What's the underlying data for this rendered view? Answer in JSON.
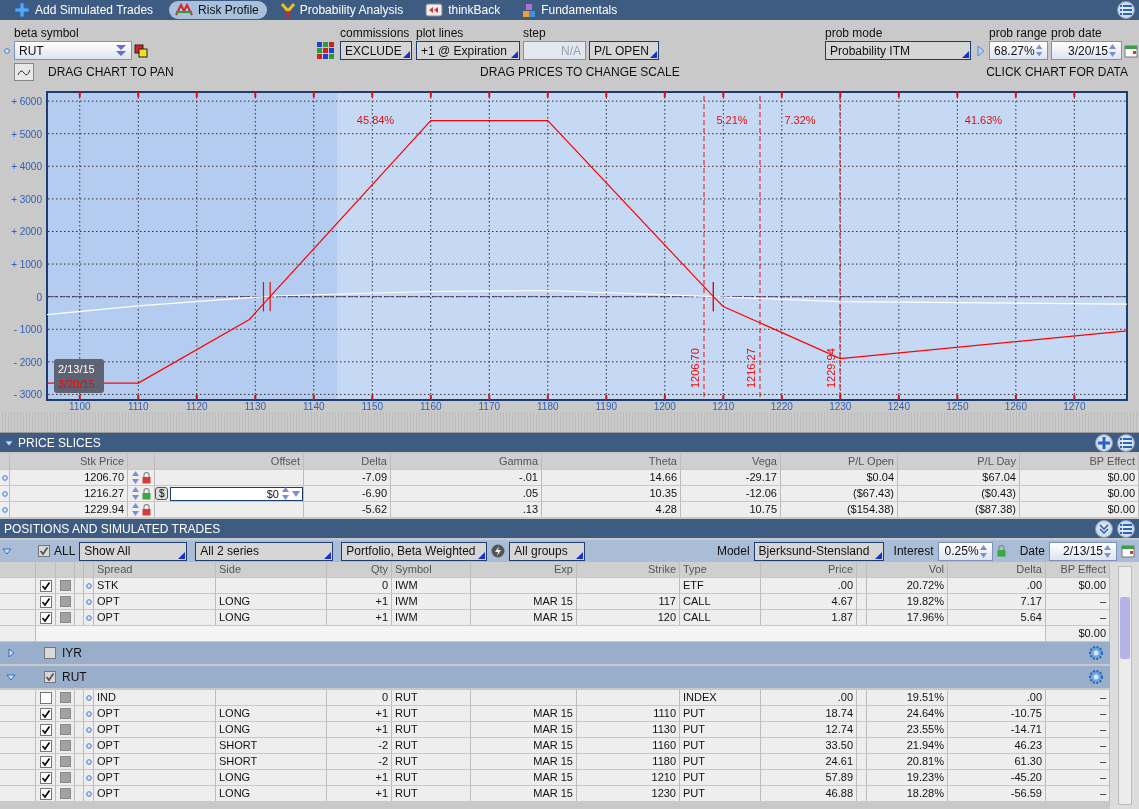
{
  "tabs": [
    {
      "label": "Add Simulated Trades",
      "selected": false
    },
    {
      "label": "Risk Profile",
      "selected": true
    },
    {
      "label": "Probability Analysis",
      "selected": false
    },
    {
      "label": "thinkBack",
      "selected": false
    },
    {
      "label": "Fundamentals",
      "selected": false
    }
  ],
  "controls": {
    "beta_symbol": {
      "label": "beta symbol",
      "value": "RUT"
    },
    "commissions": {
      "label": "commissions",
      "value": "EXCLUDE"
    },
    "plot_lines": {
      "label": "plot lines",
      "value": "+1 @ Expiration"
    },
    "step": {
      "label": "step",
      "value": "N/A",
      "disabled": true
    },
    "pl_mode": {
      "value": "P/L OPEN"
    },
    "prob_mode": {
      "label": "prob mode",
      "value": "Probability ITM"
    },
    "prob_range": {
      "label": "prob range",
      "value": "68.27%"
    },
    "prob_date": {
      "label": "prob date",
      "value": "3/20/15"
    }
  },
  "hints": [
    "DRAG CHART TO PAN",
    "DRAG PRICES TO CHANGE SCALE",
    "CLICK CHART FOR DATA"
  ],
  "chart": {
    "chart_data": {
      "type": "line",
      "x": [
        1094.4,
        1110,
        1129,
        1133,
        1160,
        1180,
        1208.3,
        1210,
        1230,
        1279
      ],
      "series": [
        {
          "name": "2/13/15",
          "color": "#ffffff",
          "values": [
            -550,
            -280,
            -30,
            20,
            160,
            190,
            0,
            -10,
            -150,
            -230
          ]
        },
        {
          "name": "3/20/15",
          "color": "#ff0000",
          "values": [
            -2650,
            -2650,
            -700,
            90,
            5400,
            5400,
            0,
            -300,
            -1900,
            -1050
          ]
        }
      ],
      "xlim": [
        1094.4,
        1279
      ],
      "ylim": [
        -3170,
        6280
      ],
      "xticks": [
        1100,
        1110,
        1120,
        1130,
        1140,
        1150,
        1160,
        1170,
        1180,
        1190,
        1200,
        1210,
        1220,
        1230,
        1240,
        1250,
        1260,
        1270
      ],
      "yticks": [
        {
          "value": 6000,
          "label": "+ 6000"
        },
        {
          "value": 5000,
          "label": "+ 5000"
        },
        {
          "value": 4000,
          "label": "+ 4000"
        },
        {
          "value": 3000,
          "label": "+ 3000"
        },
        {
          "value": 2000,
          "label": "+ 2000"
        },
        {
          "value": 1000,
          "label": "+ 1000"
        },
        {
          "value": 0,
          "label": "0"
        },
        {
          "value": -1000,
          "label": "- 1000"
        },
        {
          "value": -2000,
          "label": "- 2000"
        },
        {
          "value": -3000,
          "label": "- 3000"
        }
      ],
      "grid": true,
      "bands": [
        {
          "axis": "x",
          "from": 1094.4,
          "to": 1144
        }
      ],
      "ref_lines": [
        {
          "axis": "x",
          "value": 1206.7,
          "label": "1206.70"
        },
        {
          "axis": "x",
          "value": 1216.27,
          "label": "1216.27"
        },
        {
          "axis": "x",
          "value": 1229.94,
          "label": "1229.94"
        },
        {
          "axis": "y",
          "value": 0
        }
      ],
      "annotations": [
        "45.84%",
        "5.21%",
        "7.32%",
        "41.63%"
      ]
    }
  },
  "price_slices": {
    "title": "PRICE SLICES",
    "columns": [
      "Stk Price",
      "Offset",
      "Delta",
      "Gamma",
      "Theta",
      "Vega",
      "P/L Open",
      "P/L Day",
      "BP Effect"
    ],
    "rows": [
      {
        "stk_price": "1206.70",
        "color": "#d83a3a",
        "delta": "-7.09",
        "gamma": "-.01",
        "theta": "14.66",
        "vega": "-29.17",
        "pl_open": "$0.04",
        "pl_day": "$67.04",
        "bp_effect": "$0.00"
      },
      {
        "stk_price": "1216.27",
        "color": "#3aa83a",
        "currency_button": "$",
        "offset": "$0",
        "delta": "-6.90",
        "gamma": ".05",
        "theta": "10.35",
        "vega": "-12.06",
        "pl_open": "($67.43)",
        "pl_day": "($0.43)",
        "bp_effect": "$0.00"
      },
      {
        "stk_price": "1229.94",
        "color": "#d83a3a",
        "delta": "-5.62",
        "gamma": ".13",
        "theta": "4.28",
        "vega": "10.75",
        "pl_open": "($154.38)",
        "pl_day": "($87.38)",
        "bp_effect": "$0.00"
      }
    ]
  },
  "positions": {
    "title": "POSITIONS AND SIMULATED TRADES",
    "filter": {
      "all_checked": true,
      "all_label": "ALL",
      "show": "Show All",
      "series": "All 2 series",
      "weighting": "Portfolio, Beta Weighted",
      "groups": "All groups",
      "model_label": "Model",
      "model": "Bjerksund-Stensland",
      "interest_label": "Interest",
      "interest": "0.25%",
      "date_label": "Date",
      "date": "2/13/15"
    },
    "columns": [
      "Spread",
      "Side",
      "Qty",
      "Symbol",
      "Exp",
      "Strike",
      "Type",
      "Price",
      "Vol",
      "Delta",
      "BP Effect"
    ],
    "rows": [
      {
        "kind": "trade",
        "checked": true,
        "spread": "STK",
        "side": "",
        "qty": "0",
        "symbol": "IWM",
        "exp": "",
        "strike": "",
        "type": "ETF",
        "price": ".00",
        "vol": "20.72%",
        "delta": ".00",
        "bp_effect": "$0.00"
      },
      {
        "kind": "trade",
        "checked": true,
        "spread": "OPT",
        "side": "LONG",
        "qty": "+1",
        "symbol": "IWM",
        "exp": "MAR 15",
        "strike": "117",
        "type": "CALL",
        "price": "4.67",
        "vol": "19.82%",
        "delta": "7.17",
        "bp_effect": "–"
      },
      {
        "kind": "trade",
        "checked": true,
        "spread": "OPT",
        "side": "LONG",
        "qty": "+1",
        "symbol": "IWM",
        "exp": "MAR 15",
        "strike": "120",
        "type": "CALL",
        "price": "1.87",
        "vol": "17.96%",
        "delta": "5.64",
        "bp_effect": "–"
      },
      {
        "kind": "subtotal",
        "bp_effect": "$0.00"
      },
      {
        "kind": "group",
        "name": "IYR",
        "expanded": false,
        "checked": false
      },
      {
        "kind": "group",
        "name": "RUT",
        "expanded": true,
        "checked": true
      },
      {
        "kind": "trade",
        "checked": false,
        "spread": "IND",
        "side": "",
        "qty": "0",
        "symbol": "RUT",
        "exp": "",
        "strike": "",
        "type": "INDEX",
        "price": ".00",
        "vol": "19.51%",
        "delta": ".00",
        "bp_effect": "–"
      },
      {
        "kind": "trade",
        "checked": true,
        "spread": "OPT",
        "side": "LONG",
        "qty": "+1",
        "symbol": "RUT",
        "exp": "MAR 15",
        "strike": "1110",
        "type": "PUT",
        "price": "18.74",
        "vol": "24.64%",
        "delta": "-10.75",
        "bp_effect": "–"
      },
      {
        "kind": "trade",
        "checked": true,
        "spread": "OPT",
        "side": "LONG",
        "qty": "+1",
        "symbol": "RUT",
        "exp": "MAR 15",
        "strike": "1130",
        "type": "PUT",
        "price": "12.74",
        "vol": "23.55%",
        "delta": "-14.71",
        "bp_effect": "–"
      },
      {
        "kind": "trade",
        "checked": true,
        "spread": "OPT",
        "side": "SHORT",
        "qty": "-2",
        "symbol": "RUT",
        "exp": "MAR 15",
        "strike": "1160",
        "type": "PUT",
        "price": "33.50",
        "vol": "21.94%",
        "delta": "46.23",
        "bp_effect": "–"
      },
      {
        "kind": "trade",
        "checked": true,
        "spread": "OPT",
        "side": "SHORT",
        "qty": "-2",
        "symbol": "RUT",
        "exp": "MAR 15",
        "strike": "1180",
        "type": "PUT",
        "price": "24.61",
        "vol": "20.81%",
        "delta": "61.30",
        "bp_effect": "–"
      },
      {
        "kind": "trade",
        "checked": true,
        "spread": "OPT",
        "side": "LONG",
        "qty": "+1",
        "symbol": "RUT",
        "exp": "MAR 15",
        "strike": "1210",
        "type": "PUT",
        "price": "57.89",
        "vol": "19.23%",
        "delta": "-45.20",
        "bp_effect": "–"
      },
      {
        "kind": "trade",
        "checked": true,
        "spread": "OPT",
        "side": "LONG",
        "qty": "+1",
        "symbol": "RUT",
        "exp": "MAR 15",
        "strike": "1230",
        "type": "PUT",
        "price": "46.88",
        "vol": "18.28%",
        "delta": "-56.59",
        "bp_effect": "–"
      }
    ]
  }
}
